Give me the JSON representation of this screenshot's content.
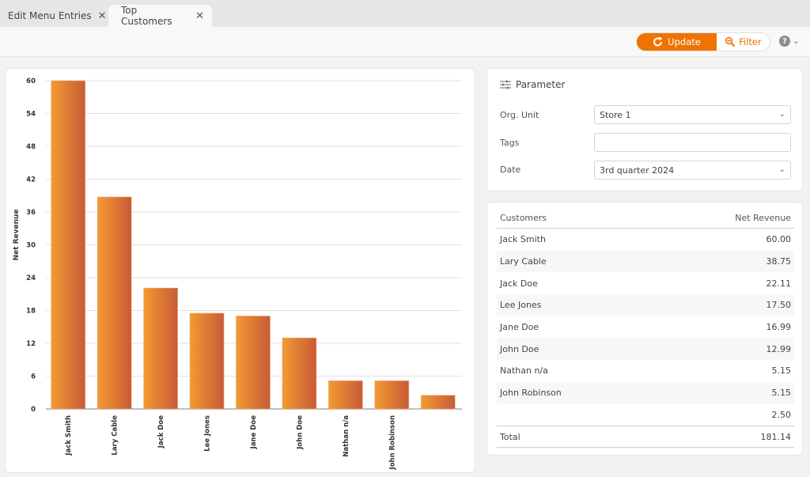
{
  "tabs": [
    {
      "label": "Edit Menu Entries",
      "active": false
    },
    {
      "label": "Top Customers",
      "active": true
    }
  ],
  "toolbar": {
    "update_label": "Update",
    "filter_label": "Filter",
    "help_label": "?"
  },
  "colors": {
    "accent": "#ef7300",
    "bar_light": "#f39a33",
    "bar_dark": "#c85a36"
  },
  "parameter": {
    "title": "Parameter",
    "fields": [
      {
        "label": "Org. Unit",
        "value": "Store 1",
        "type": "select"
      },
      {
        "label": "Tags",
        "value": "",
        "type": "input"
      },
      {
        "label": "Date",
        "value": "3rd quarter 2024",
        "type": "select"
      }
    ]
  },
  "table": {
    "headers": [
      "Customers",
      "Net Revenue"
    ],
    "rows": [
      {
        "customer": "Jack Smith",
        "revenue": "60.00"
      },
      {
        "customer": "Lary Cable",
        "revenue": "38.75"
      },
      {
        "customer": "Jack Doe",
        "revenue": "22.11"
      },
      {
        "customer": "Lee Jones",
        "revenue": "17.50"
      },
      {
        "customer": "Jane Doe",
        "revenue": "16.99"
      },
      {
        "customer": "John Doe",
        "revenue": "12.99"
      },
      {
        "customer": "Nathan n/a",
        "revenue": "5.15"
      },
      {
        "customer": "John Robinson",
        "revenue": "5.15"
      },
      {
        "customer": "",
        "revenue": "2.50"
      }
    ],
    "total_label": "Total",
    "total_value": "181.14"
  },
  "chart_data": {
    "type": "bar",
    "title": "",
    "xlabel": "",
    "ylabel": "Net Revenue",
    "categories": [
      "Jack Smith",
      "Lary Cable",
      "Jack Doe",
      "Lee Jones",
      "Jane Doe",
      "John Doe",
      "Nathan n/a",
      "John Robinson",
      ""
    ],
    "values": [
      60.0,
      38.75,
      22.11,
      17.5,
      16.99,
      12.99,
      5.15,
      5.15,
      2.5
    ],
    "ylim": [
      0,
      60
    ],
    "yticks": [
      0,
      6,
      12,
      18,
      24,
      30,
      36,
      42,
      48,
      54,
      60
    ],
    "grid": true,
    "legend": "none"
  }
}
